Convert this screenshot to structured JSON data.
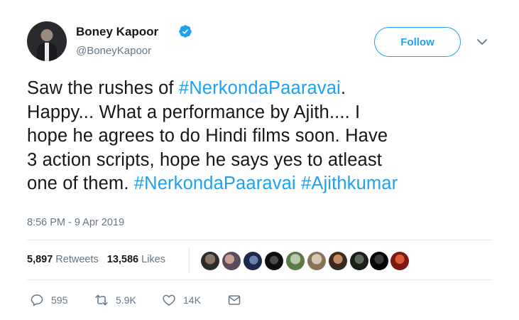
{
  "user": {
    "name": "Boney Kapoor",
    "handle": "@BoneyKapoor"
  },
  "follow_label": "Follow",
  "tweet": {
    "line1_pre": "Saw the rushes of ",
    "line1_tag": "#NerkondaPaaravai",
    "line1_post": ".",
    "line2": "Happy... What a performance by Ajith.... I",
    "line3": "hope he agrees to do Hindi films soon. Have",
    "line4": "3 action scripts, hope he says yes to atleast",
    "line5_pre": "one of them. ",
    "line5_tag1": "#NerkondaPaaravai",
    "line5_tag2": "#Ajithkumar"
  },
  "timestamp": "8:56 PM - 9 Apr 2019",
  "stats": {
    "retweets_count": "5,897",
    "retweets_label": "Retweets",
    "likes_count": "13,586",
    "likes_label": "Likes"
  },
  "likers": [
    "liker-1",
    "liker-2",
    "liker-3",
    "liker-4",
    "liker-5",
    "liker-6",
    "liker-7",
    "liker-8",
    "liker-9",
    "liker-10"
  ],
  "actions": {
    "replies": "595",
    "retweets": "5.9K",
    "likes": "14K"
  },
  "colors": {
    "accent": "#1da1f2",
    "muted": "#657786",
    "text": "#14171a"
  }
}
